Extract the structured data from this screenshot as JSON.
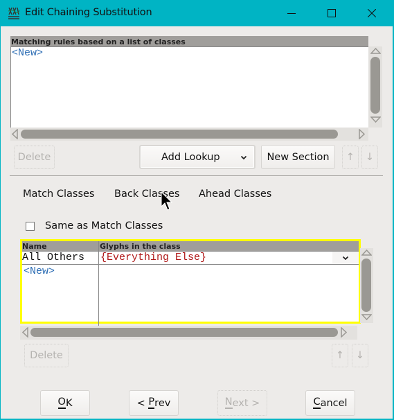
{
  "window": {
    "title": "Edit Chaining Substitution",
    "app_icon": "fontforge-icon",
    "controls": {
      "minimize": "minimize-icon",
      "maximize": "maximize-icon",
      "close": "close-icon"
    },
    "accent_color": "#00b4c4"
  },
  "rules_list": {
    "header": "Matching rules based on a list of classes",
    "items": [
      "<New>"
    ]
  },
  "rules_buttons": {
    "delete_label": "Delete",
    "add_lookup_label": "Add Lookup",
    "new_section_label": "New Section",
    "move_up_icon": "↑",
    "move_down_icon": "↓"
  },
  "class_tabs": [
    {
      "label": "Match Classes"
    },
    {
      "label": "Back Classes"
    },
    {
      "label": "Ahead Classes"
    }
  ],
  "same_as_match": {
    "label": "Same as Match Classes",
    "checked": false
  },
  "classes_table": {
    "columns": [
      "Name",
      "Glyphs in the class"
    ],
    "rows": [
      {
        "name": "All Others",
        "glyphs": "{Everything Else}"
      }
    ],
    "new_row_label": "<New>",
    "highlight_color": "#ffff00"
  },
  "classes_buttons": {
    "delete_label": "Delete",
    "move_up_icon": "↑",
    "move_down_icon": "↓"
  },
  "footer": {
    "ok": {
      "prefix": "",
      "mnemonic": "O",
      "rest": "K"
    },
    "prev": {
      "prefix": "< ",
      "mnemonic": "P",
      "rest": "rev"
    },
    "next": {
      "prefix": "",
      "mnemonic": "N",
      "rest": "ext >"
    },
    "cancel": {
      "prefix": "",
      "mnemonic": "C",
      "rest": "ancel"
    }
  }
}
